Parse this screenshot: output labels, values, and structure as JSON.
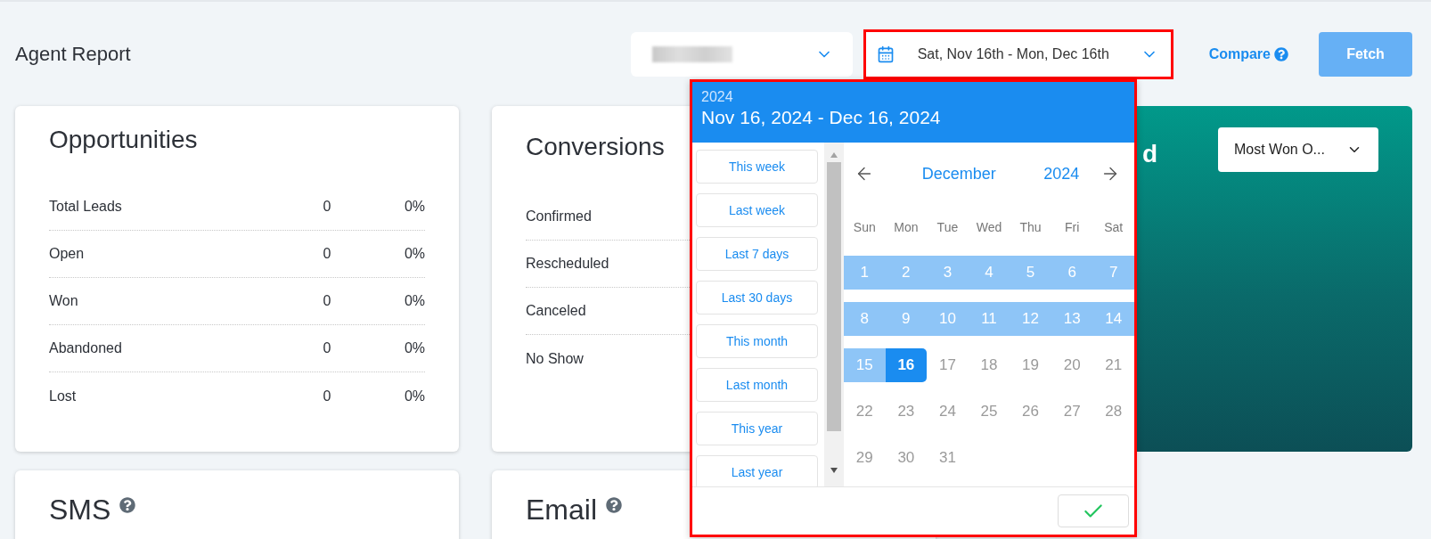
{
  "header": {
    "title": "Agent Report"
  },
  "toolbar": {
    "date_range": {
      "value": "Sat, Nov 16th - Mon, Dec 16th",
      "highlighted": true
    },
    "compare": {
      "label": "Compare"
    },
    "fetch": {
      "label": "Fetch",
      "disabled": true
    }
  },
  "stat_cards": [
    {
      "title": "Opportunities",
      "rows": [
        {
          "label": "Total Leads",
          "count": "0",
          "percent": "0%"
        },
        {
          "label": "Open",
          "count": "0",
          "percent": "0%"
        },
        {
          "label": "Won",
          "count": "0",
          "percent": "0%"
        },
        {
          "label": "Abandoned",
          "count": "0",
          "percent": "0%"
        },
        {
          "label": "Lost",
          "count": "0",
          "percent": "0%"
        }
      ]
    },
    {
      "title": "Conversions",
      "rows": [
        {
          "label": "Confirmed"
        },
        {
          "label": "Rescheduled"
        },
        {
          "label": "Canceled"
        },
        {
          "label": "No Show"
        }
      ]
    }
  ],
  "leaderboard_card": {
    "title": "d",
    "dropdown": "Most Won O..."
  },
  "bottom_cards": [
    {
      "title": "SMS"
    },
    {
      "title": "Email"
    }
  ],
  "datepicker": {
    "highlighted": true,
    "year": "2024",
    "range": "Nov 16, 2024 - Dec 16, 2024",
    "presets": [
      "This week",
      "Last week",
      "Last 7 days",
      "Last 30 days",
      "This month",
      "Last month",
      "This year",
      "Last year"
    ],
    "month": "December",
    "calendar_year": "2024",
    "weekdays": [
      "Sun",
      "Mon",
      "Tue",
      "Wed",
      "Thu",
      "Fri",
      "Sat"
    ],
    "weeks": [
      [
        {
          "day": "1",
          "kind": "range"
        },
        {
          "day": "2",
          "kind": "range"
        },
        {
          "day": "3",
          "kind": "range"
        },
        {
          "day": "4",
          "kind": "range"
        },
        {
          "day": "5",
          "kind": "range"
        },
        {
          "day": "6",
          "kind": "range"
        },
        {
          "day": "7",
          "kind": "range"
        }
      ],
      [
        {
          "day": "8",
          "kind": "range"
        },
        {
          "day": "9",
          "kind": "range"
        },
        {
          "day": "10",
          "kind": "range"
        },
        {
          "day": "11",
          "kind": "range"
        },
        {
          "day": "12",
          "kind": "range"
        },
        {
          "day": "13",
          "kind": "range"
        },
        {
          "day": "14",
          "kind": "range"
        }
      ],
      [
        {
          "day": "15",
          "kind": "range"
        },
        {
          "day": "16",
          "kind": "end"
        },
        {
          "day": "17",
          "kind": "disabled"
        },
        {
          "day": "18",
          "kind": "disabled"
        },
        {
          "day": "19",
          "kind": "disabled"
        },
        {
          "day": "20",
          "kind": "disabled"
        },
        {
          "day": "21",
          "kind": "disabled"
        }
      ],
      [
        {
          "day": "22",
          "kind": "disabled"
        },
        {
          "day": "23",
          "kind": "disabled"
        },
        {
          "day": "24",
          "kind": "disabled"
        },
        {
          "day": "25",
          "kind": "disabled"
        },
        {
          "day": "26",
          "kind": "disabled"
        },
        {
          "day": "27",
          "kind": "disabled"
        },
        {
          "day": "28",
          "kind": "disabled"
        }
      ],
      [
        {
          "day": "29",
          "kind": "disabled"
        },
        {
          "day": "30",
          "kind": "disabled"
        },
        {
          "day": "31",
          "kind": "disabled"
        }
      ]
    ]
  }
}
